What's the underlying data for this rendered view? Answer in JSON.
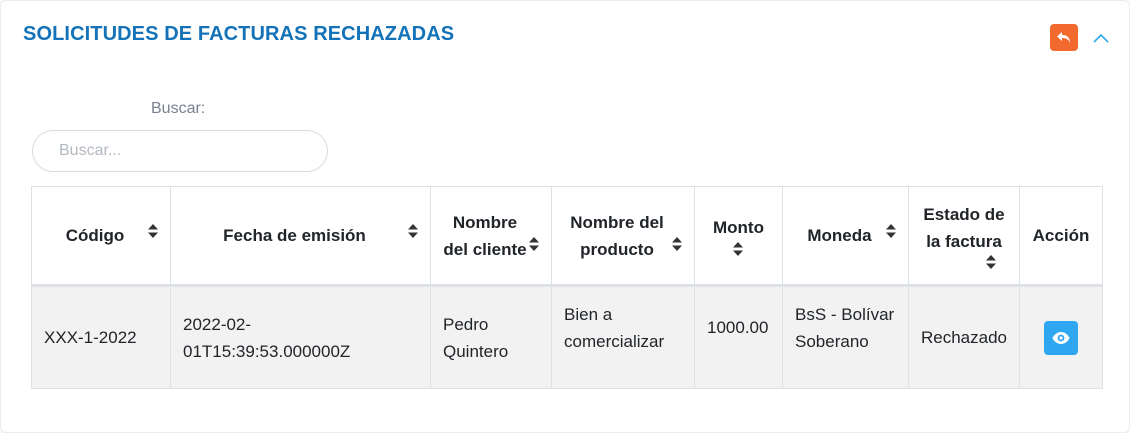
{
  "card": {
    "title": "SOLICITUDES DE FACTURAS RECHAZADAS",
    "icons": {
      "back": "reply-icon",
      "collapse": "chevron-up-icon"
    },
    "colors": {
      "title": "#1473b8",
      "back_button": "#f26a2e",
      "view_button": "#2ea6f0"
    }
  },
  "search": {
    "label": "Buscar:",
    "placeholder": "Buscar...",
    "value": ""
  },
  "table": {
    "columns": [
      {
        "label": "Código",
        "sortable": true
      },
      {
        "label": "Fecha de emisión",
        "sortable": true
      },
      {
        "label": "Nombre del cliente",
        "sortable": true
      },
      {
        "label": "Nombre del producto",
        "sortable": true
      },
      {
        "label": "Monto",
        "sortable": true
      },
      {
        "label": "Moneda",
        "sortable": true
      },
      {
        "label": "Estado de la factura",
        "sortable": true
      },
      {
        "label": "Acción",
        "sortable": false
      }
    ],
    "rows": [
      {
        "codigo": "XXX-1-2022",
        "fecha": "2022-02-01T15:39:53.000000Z",
        "cliente": "Pedro Quintero",
        "producto": "Bien a comercializar",
        "monto": "1000.00",
        "moneda": "BsS - Bolívar Soberano",
        "estado": "Rechazado",
        "action_icon": "eye-icon"
      }
    ]
  }
}
